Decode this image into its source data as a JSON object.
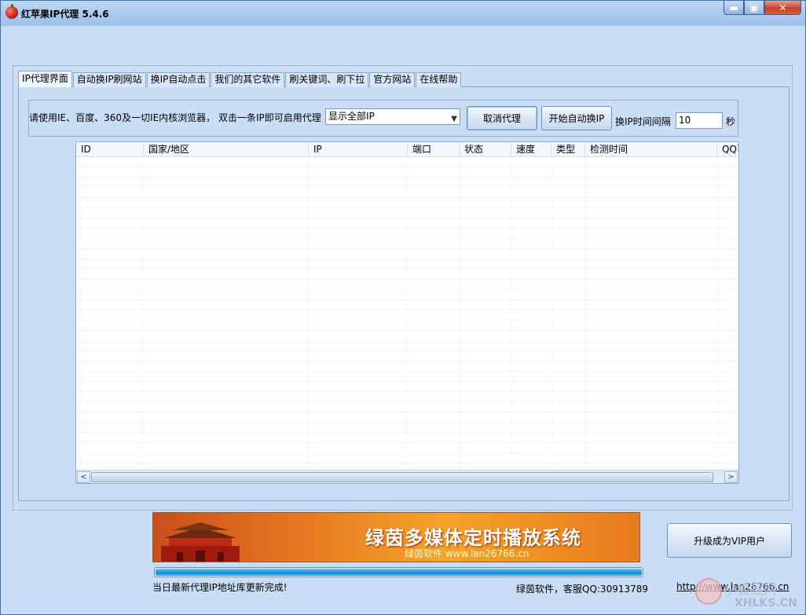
{
  "window": {
    "title": "红苹果IP代理  5.4.6",
    "minimize_glyph": "▬",
    "maximize_glyph": "▣",
    "close_glyph": "✕"
  },
  "tabs": [
    {
      "label": "IP代理界面",
      "active": true
    },
    {
      "label": "自动换IP刷网站"
    },
    {
      "label": "换IP自动点击"
    },
    {
      "label": "我们的其它软件"
    },
    {
      "label": "刷关键词、刷下拉"
    },
    {
      "label": "官方网站"
    },
    {
      "label": "在线帮助"
    }
  ],
  "toolbar": {
    "hint": "请使用IE、百度、360及一切IE内核浏览器， 双击一条IP即可启用代理",
    "filter_value": "显示全部IP",
    "cancel_label": "取消代理",
    "auto_label": "开始自动换IP",
    "interval_label": "换IP时间间隔",
    "interval_value": "10",
    "seconds_label": "秒"
  },
  "table": {
    "columns": [
      "ID",
      "国家/地区",
      "IP",
      "端口",
      "状态",
      "速度",
      "类型",
      "检测时间",
      "QQ可"
    ],
    "rows": []
  },
  "banner": {
    "title": "绿茵多媒体定时播放系统",
    "subtitle": "绿茵软件  www.lan26766.cn"
  },
  "progress": {
    "value_percent": 100
  },
  "vip_button": "升级成为VIP用户",
  "status": {
    "message": "当日最新代理IP地址库更新完成!",
    "company": "绿茵软件，客服QQ:30913789",
    "link": "http://www.lan26766.cn"
  },
  "watermark": {
    "line1": "小狐狸网",
    "line2": "XHLKS.CN"
  },
  "colors": {
    "window_bg": "#c9def5",
    "accent": "#1a8ad6"
  }
}
